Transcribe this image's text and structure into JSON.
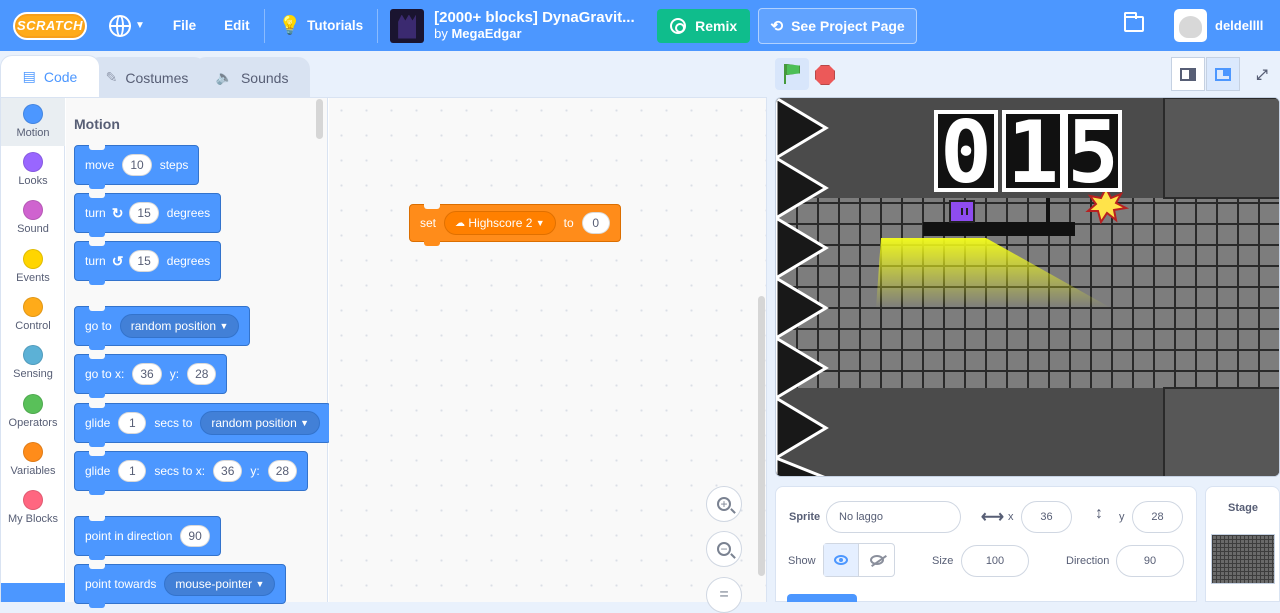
{
  "menubar": {
    "logo": "SCRATCH",
    "file": "File",
    "edit": "Edit",
    "tutorials": "Tutorials",
    "project_title": "[2000+ blocks] DynaGravit...",
    "by_prefix": "by",
    "author": "MegaEdgar",
    "remix": "Remix",
    "see_project_page": "See Project Page",
    "username": "deldellll"
  },
  "tabs": {
    "code": "Code",
    "costumes": "Costumes",
    "sounds": "Sounds"
  },
  "categories": [
    {
      "label": "Motion",
      "color": "#4c97ff"
    },
    {
      "label": "Looks",
      "color": "#9966ff"
    },
    {
      "label": "Sound",
      "color": "#cf63cf"
    },
    {
      "label": "Events",
      "color": "#ffd500"
    },
    {
      "label": "Control",
      "color": "#ffab19"
    },
    {
      "label": "Sensing",
      "color": "#5cb1d6"
    },
    {
      "label": "Operators",
      "color": "#59c059"
    },
    {
      "label": "Variables",
      "color": "#ff8c1a"
    },
    {
      "label": "My Blocks",
      "color": "#ff6680"
    }
  ],
  "palette": {
    "title": "Motion",
    "move": {
      "label": "move",
      "value": "10",
      "suffix": "steps"
    },
    "turn_right": {
      "label": "turn",
      "value": "15",
      "suffix": "degrees"
    },
    "turn_left": {
      "label": "turn",
      "value": "15",
      "suffix": "degrees"
    },
    "goto": {
      "label": "go to",
      "option": "random position"
    },
    "gotoxy": {
      "label": "go to x:",
      "x": "36",
      "ylabel": "y:",
      "y": "28"
    },
    "glide_to": {
      "label": "glide",
      "secs": "1",
      "mid": "secs to",
      "option": "random position"
    },
    "glide_xy": {
      "label": "glide",
      "secs": "1",
      "mid": "secs to x:",
      "x": "36",
      "ylabel": "y:",
      "y": "28"
    },
    "point_dir": {
      "label": "point in direction",
      "value": "90"
    },
    "point_towards": {
      "label": "point towards",
      "option": "mouse-pointer"
    }
  },
  "script": {
    "set_label": "set",
    "variable": "Highscore 2",
    "to_label": "to",
    "value": "0"
  },
  "stage": {
    "score": "015"
  },
  "sprite_info": {
    "sprite_label": "Sprite",
    "sprite_name": "No laggo",
    "x_label": "x",
    "x": "36",
    "y_label": "y",
    "y": "28",
    "show_label": "Show",
    "size_label": "Size",
    "size": "100",
    "direction_label": "Direction",
    "direction": "90"
  },
  "stage_pane": {
    "title": "Stage"
  }
}
